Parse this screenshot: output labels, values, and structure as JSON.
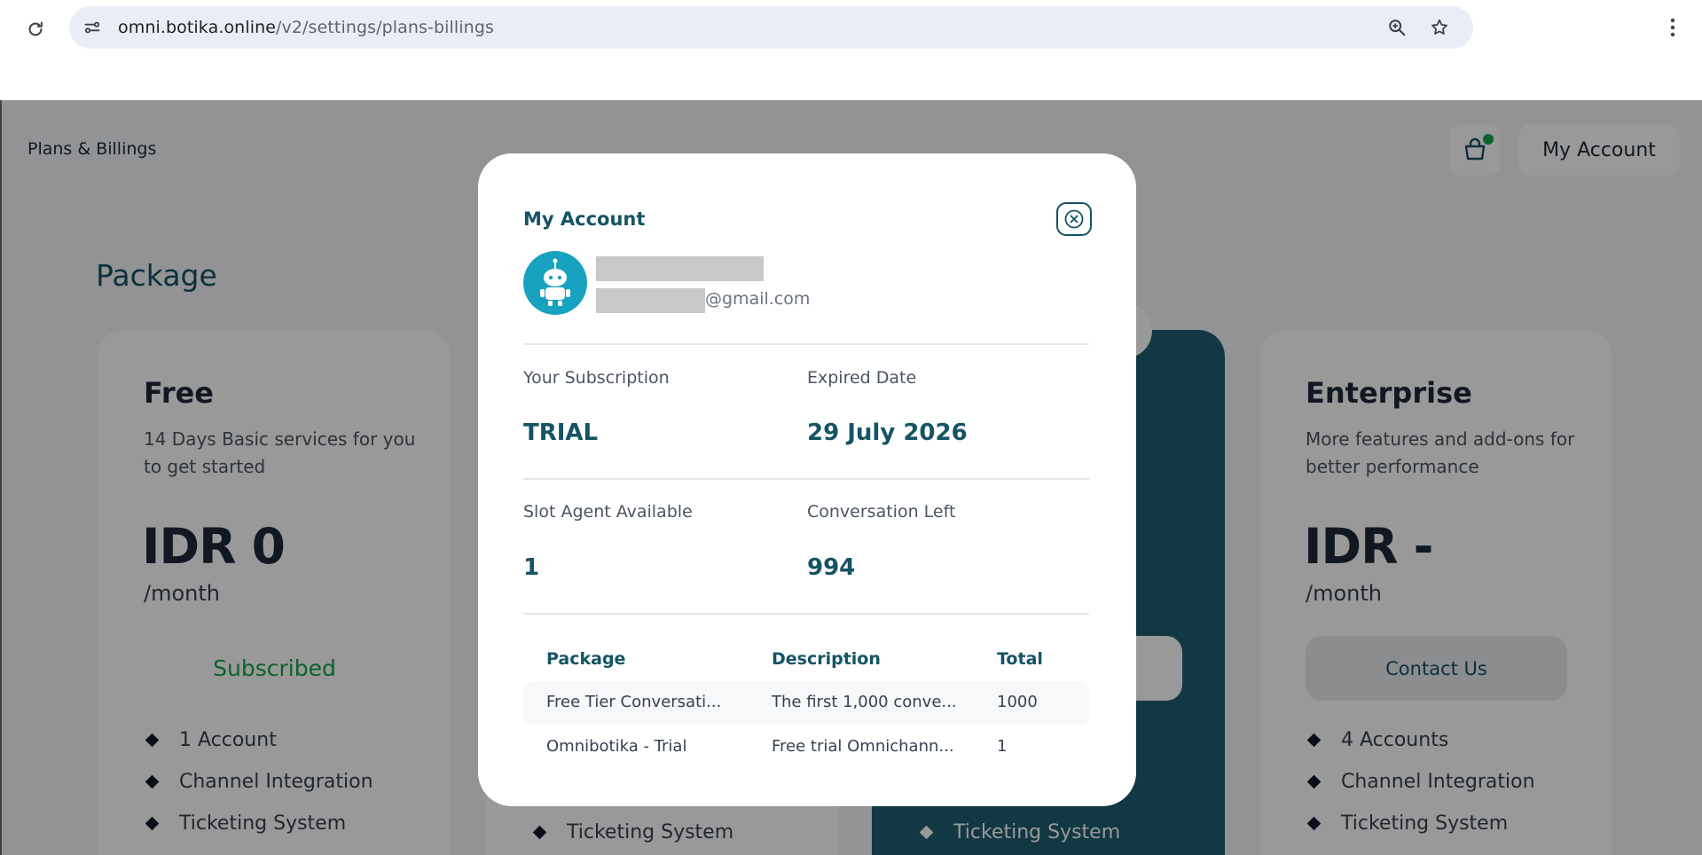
{
  "browser": {
    "url_host": "omni.botika.online",
    "url_path": "/v2/settings/plans-billings",
    "icons": [
      "reload-icon",
      "site-info-icon",
      "zoom-icon",
      "star-icon",
      "kebab-menu-icon"
    ]
  },
  "header": {
    "title": "Plans & Billings",
    "account_label": "My Account",
    "cart_icon": "cart-icon"
  },
  "package": {
    "section_title": "Package",
    "plans": [
      {
        "name": "Free",
        "description": "14 Days Basic services for you to get started",
        "price": "IDR 0",
        "period": "/month",
        "cta": "Subscribed",
        "features": [
          "1 Account",
          "Channel Integration",
          "Ticketing System"
        ]
      },
      {
        "features": [
          "Ticketing System"
        ]
      },
      {
        "features": [
          "Ticketing System"
        ]
      },
      {
        "name": "Enterprise",
        "description": "More features and add-ons for better performance",
        "price": "IDR -",
        "period": "/month",
        "cta": "Contact Us",
        "features": [
          "4 Accounts",
          "Channel Integration",
          "Ticketing System"
        ]
      }
    ]
  },
  "modal": {
    "title": "My Account",
    "email_domain": "@gmail.com",
    "subscription_label": "Your Subscription",
    "subscription_value": "TRIAL",
    "expired_label": "Expired Date",
    "expired_value": "29 July 2026",
    "slot_label": "Slot Agent Available",
    "slot_value": "1",
    "conversation_label": "Conversation Left",
    "conversation_value": "994",
    "table": {
      "headers": [
        "Package",
        "Description",
        "Total"
      ],
      "rows": [
        [
          "Free Tier Conversati...",
          "The first 1,000 conve...",
          "1000"
        ],
        [
          "Omnibotika - Trial",
          "Free trial Omnichann...",
          "1"
        ]
      ]
    }
  },
  "colors": {
    "accent": "#155365",
    "success": "#16a34a",
    "avatar_bg": "#17a2c0",
    "omnibox_bg": "#e9eef6"
  }
}
